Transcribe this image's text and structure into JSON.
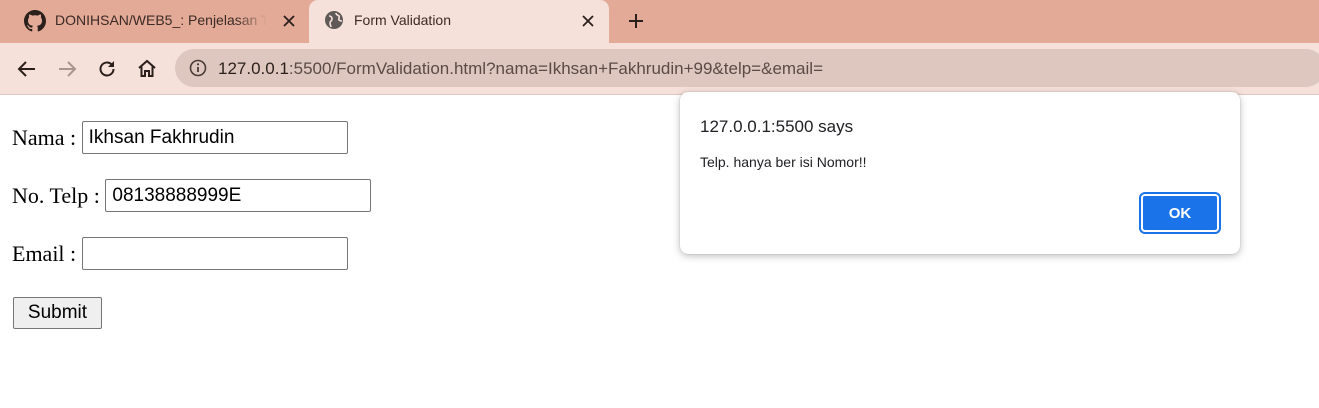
{
  "browser": {
    "tabs": [
      {
        "title": "DONIHSAN/WEB5_: Penjelasan T",
        "favicon": "github-icon",
        "active": false
      },
      {
        "title": "Form Validation",
        "favicon": "globe-icon",
        "active": true
      }
    ],
    "address": {
      "host": "127.0.0.1",
      "rest": ":5500/FormValidation.html?nama=Ikhsan+Fakhrudin+99&telp=&email="
    },
    "colors": {
      "tabstrip": "#e2aa97",
      "toolbar": "#f6e0da",
      "omnibox": "#dec7bf"
    }
  },
  "form": {
    "nama": {
      "label": "Nama : ",
      "value": "Ikhsan Fakhrudin"
    },
    "telp": {
      "label": "No. Telp : ",
      "value": "08138888999E"
    },
    "email": {
      "label": "Email : ",
      "value": ""
    },
    "submit_label": "Submit"
  },
  "dialog": {
    "title": "127.0.0.1:5500 says",
    "message": "Telp. hanya ber isi Nomor!!",
    "ok_label": "OK",
    "accent": "#1a73e8"
  }
}
